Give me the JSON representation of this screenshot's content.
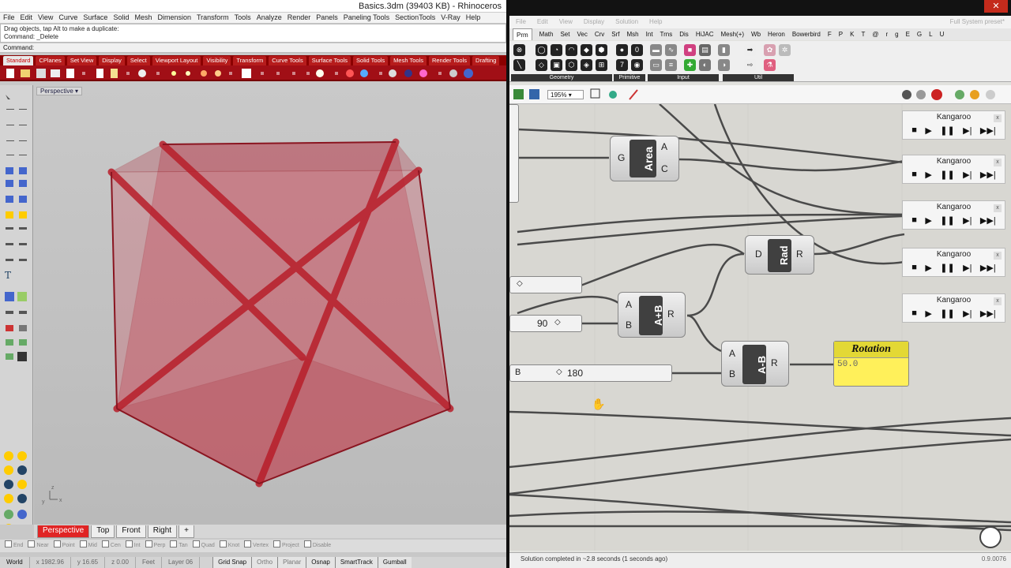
{
  "rhino": {
    "title": "Basics.3dm (39403 KB) - Rhinoceros",
    "menu": [
      "File",
      "Edit",
      "View",
      "Curve",
      "Surface",
      "Solid",
      "Mesh",
      "Dimension",
      "Transform",
      "Tools",
      "Analyze",
      "Render",
      "Panels",
      "Paneling Tools",
      "SectionTools",
      "V-Ray",
      "Help"
    ],
    "history": [
      "Drag objects, tap Alt to make a duplicate:",
      "Command: _Delete"
    ],
    "command_label": "Command:",
    "toolbar_tabs": [
      "Standard",
      "CPlanes",
      "Set View",
      "Display",
      "Select",
      "Viewport Layout",
      "Visibility",
      "Transform",
      "Curve Tools",
      "Surface Tools",
      "Solid Tools",
      "Mesh Tools",
      "Render Tools",
      "Drafting"
    ],
    "active_tab": "Standard",
    "viewport_label": "Perspective",
    "view_tabs": [
      "Perspective",
      "Top",
      "Front",
      "Right",
      "+"
    ],
    "active_view": "Perspective",
    "osnaps": [
      "End",
      "Near",
      "Point",
      "Mid",
      "Cen",
      "Int",
      "Perp",
      "Tan",
      "Quad",
      "Knot",
      "Vertex",
      "Project",
      "Disable"
    ],
    "status": {
      "cplane": "World",
      "x": "x 1982.96",
      "y": "y 16.65",
      "z": "z 0.00",
      "units": "Feet",
      "layer": "Layer 06"
    },
    "status_buttons": [
      "Grid Snap",
      "Ortho",
      "Planar",
      "Osnap",
      "SmartTrack",
      "Gumball"
    ],
    "axis": {
      "x": "x",
      "y": "y",
      "z": "z"
    }
  },
  "gh": {
    "close": "✕",
    "menu": [
      "File",
      "Edit",
      "View",
      "Display",
      "Solution",
      "Help"
    ],
    "menu_right": "Full System preset*",
    "tabs": [
      "Prm",
      "Math",
      "Set",
      "Vec",
      "Crv",
      "Srf",
      "Msh",
      "Int",
      "Trns",
      "Dis",
      "HiJAC",
      "Mesh(+)",
      "Wb",
      "Heron",
      "Bowerbird",
      "F",
      "P",
      "K",
      "T",
      "@",
      "r",
      "g",
      "E",
      "G",
      "L",
      "U"
    ],
    "active_tab": "Prm",
    "groups": [
      "Geometry",
      "Primitive",
      "Input",
      "Util"
    ],
    "zoom": "195%",
    "nodes": {
      "area": {
        "label": "Area",
        "in": "G",
        "out1": "A",
        "out2": "C"
      },
      "rad": {
        "label": "Rad",
        "in": "D",
        "out": "R"
      },
      "add": {
        "label": "A+B",
        "in1": "A",
        "in2": "B",
        "out": "R"
      },
      "sub": {
        "label": "A-B",
        "in1": "A",
        "in2": "B",
        "out": "R"
      }
    },
    "sliders": {
      "s1": "90",
      "s2": "180",
      "s2_label": "B"
    },
    "rotation": {
      "title": "Rotation",
      "value": "50.0"
    },
    "kangaroo": [
      "Kangaroo",
      "Kangaroo",
      "Kangaroo",
      "Kangaroo",
      "Kangaroo"
    ],
    "status": "Solution completed in ~2.8 seconds (1 seconds ago)",
    "version": "0.9.0076"
  }
}
